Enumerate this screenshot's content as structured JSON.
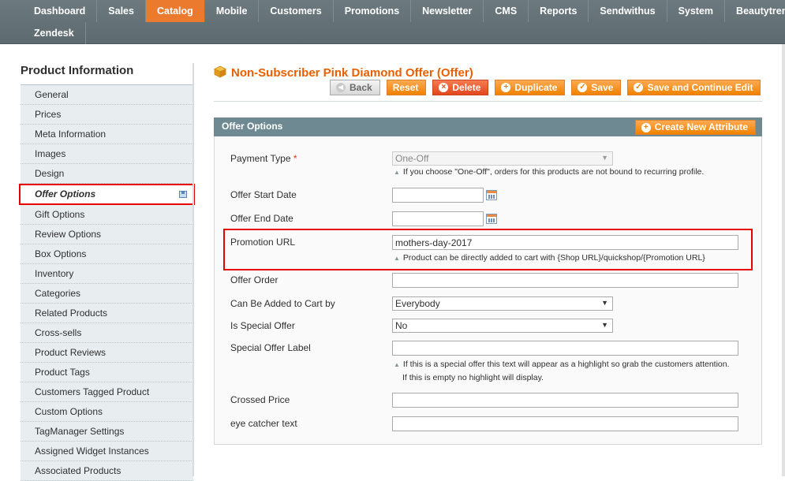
{
  "nav": {
    "row1": [
      "Dashboard",
      "Sales",
      "Catalog",
      "Mobile",
      "Customers",
      "Promotions",
      "Newsletter",
      "CMS",
      "Reports",
      "Sendwithus",
      "System",
      "Beautytrends"
    ],
    "row2": [
      "Zendesk"
    ],
    "active": "Catalog"
  },
  "sidebar": {
    "title": "Product Information",
    "items": [
      "General",
      "Prices",
      "Meta Information",
      "Images",
      "Design",
      "Offer Options",
      "Gift Options",
      "Review Options",
      "Box Options",
      "Inventory",
      "Categories",
      "Related Products",
      "Cross-sells",
      "Product Reviews",
      "Product Tags",
      "Customers Tagged Product",
      "Custom Options",
      "TagManager Settings",
      "Assigned Widget Instances",
      "Associated Products"
    ],
    "active": "Offer Options"
  },
  "header": {
    "title": "Non-Subscriber Pink Diamond Offer (Offer)",
    "buttons": {
      "back": "Back",
      "reset": "Reset",
      "delete": "Delete",
      "duplicate": "Duplicate",
      "save": "Save",
      "save_continue": "Save and Continue Edit"
    }
  },
  "fieldset": {
    "title": "Offer Options",
    "create_attribute": "Create New Attribute"
  },
  "fields": {
    "payment_type": {
      "label": "Payment Type",
      "required": "*",
      "value": "One-Off",
      "note": "If you choose \"One-Off\", orders for this products are not bound to recurring profile."
    },
    "start_date": {
      "label": "Offer Start Date",
      "value": ""
    },
    "end_date": {
      "label": "Offer End Date",
      "value": ""
    },
    "promotion_url": {
      "label": "Promotion URL",
      "value": "mothers-day-2017",
      "note": "Product can be directly added to cart with {Shop URL}/quickshop/{Promotion URL}"
    },
    "offer_order": {
      "label": "Offer Order",
      "value": ""
    },
    "added_by": {
      "label": "Can Be Added to Cart by",
      "value": "Everybody"
    },
    "special_offer": {
      "label": "Is Special Offer",
      "value": "No"
    },
    "special_label": {
      "label": "Special Offer Label",
      "value": "",
      "note1": "If this is a special offer this text will appear as a highlight so grab the customers attention.",
      "note2": "If this is empty no highlight will display."
    },
    "crossed_price": {
      "label": "Crossed Price",
      "value": ""
    },
    "eye_catcher": {
      "label": "eye catcher text",
      "value": ""
    }
  },
  "colors": {
    "accent": "#eb5e00",
    "nav_bg": "#6c7a80",
    "nav_active": "#ec7a2e",
    "highlight": "#e60000"
  }
}
